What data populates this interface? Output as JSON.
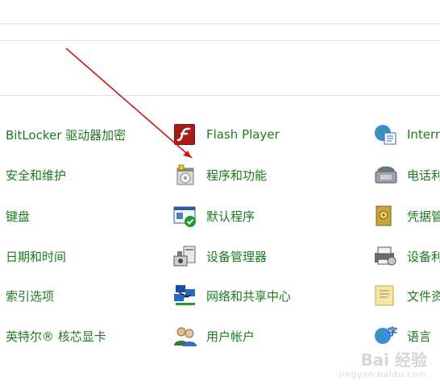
{
  "items": {
    "bitlocker": "BitLocker 驱动器加密",
    "flash": "Flash Player",
    "internet": "Intern",
    "security": "安全和维护",
    "programs": "程序和功能",
    "phone": "电话利",
    "keyboard": "键盘",
    "default_programs": "默认程序",
    "credentials": "凭据管",
    "datetime": "日期和时间",
    "device_manager": "设备管理器",
    "devices": "设备利",
    "indexing": "索引选项",
    "network": "网络和共享中心",
    "file": "文件资",
    "intel": "英特尔® 核芯显卡",
    "user": "用户帐户",
    "language": "语言"
  },
  "watermark": {
    "logo": "Bai 经验",
    "url": "jingyan.baidu.com"
  },
  "colors": {
    "link": "#1e7a20",
    "arrow": "#d11414"
  }
}
